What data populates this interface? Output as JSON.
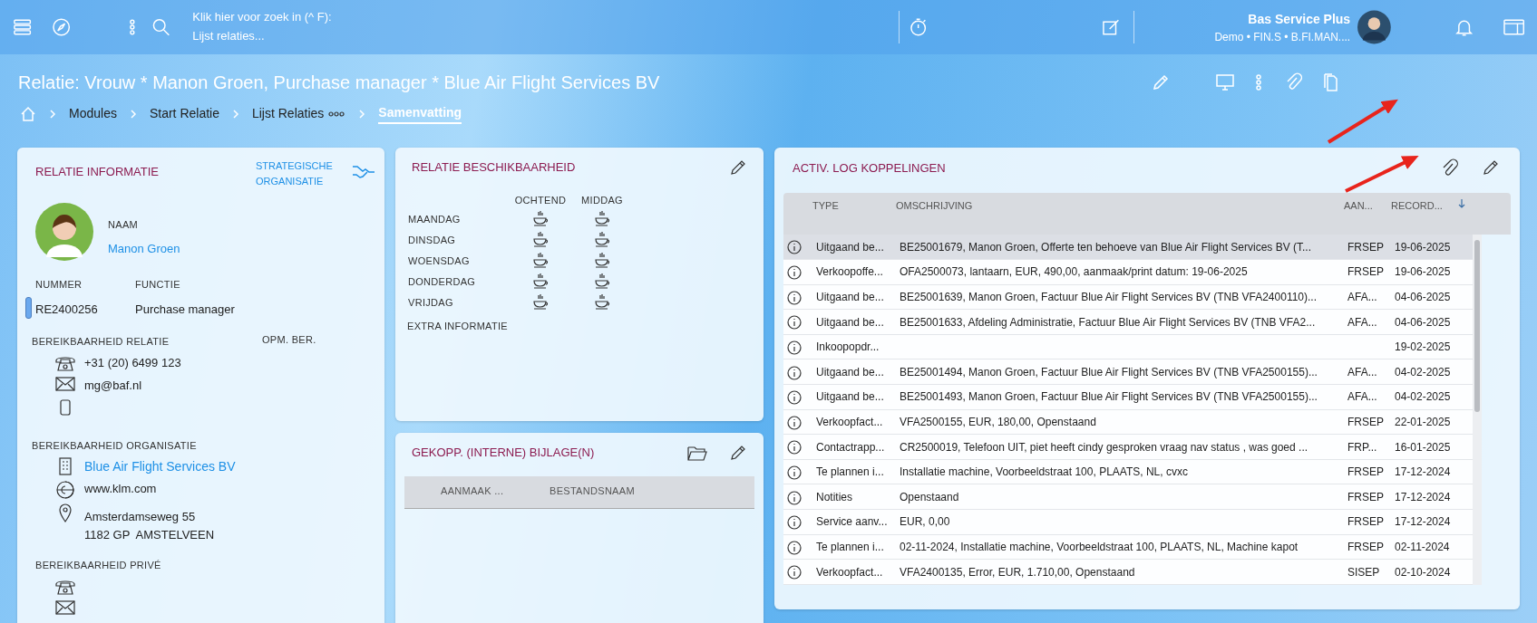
{
  "topbar": {
    "search_prompt": "Klik hier voor zoek in (^ F):",
    "search_context": "Lijst relaties...",
    "user_name": "Bas Service Plus",
    "user_context": "Demo • FIN.S • B.FI.MAN...."
  },
  "page_title": "Relatie: Vrouw * Manon Groen, Purchase manager * Blue Air Flight Services BV",
  "breadcrumbs": [
    {
      "label": "Modules",
      "menu": false,
      "selected": false
    },
    {
      "label": "Start Relatie",
      "menu": false,
      "selected": false
    },
    {
      "label": "Lijst Relaties",
      "menu": true,
      "selected": false
    },
    {
      "label": "Samenvatting",
      "menu": false,
      "selected": true
    }
  ],
  "relatie_informatie": {
    "title": "RELATIE INFORMATIE",
    "strategic_label": "STRATEGISCHE ORGANISATIE",
    "naam_label": "NAAM",
    "naam": "Manon Groen",
    "nummer_label": "NUMMER",
    "nummer": "RE2400256",
    "functie_label": "FUNCTIE",
    "functie": "Purchase manager",
    "bereikbaarheid_label": "BEREIKBAARHEID RELATIE",
    "opm_label": "OPM. BER.",
    "contacts": [
      {
        "kind": "phone",
        "text": "+31 (20) 6499 123"
      },
      {
        "kind": "email",
        "text": "mg@baf.nl"
      },
      {
        "kind": "mobile"
      }
    ],
    "organisatie_label": "BEREIKBAARHEID ORGANISATIE",
    "organisatie": [
      {
        "kind": "building",
        "text": "Blue Air Flight Services BV",
        "link": true
      },
      {
        "kind": "web",
        "text": "www.klm.com",
        "link": false
      },
      {
        "kind": "location",
        "lines": [
          "Amsterdamseweg 55",
          "1182 GP  AMSTELVEEN"
        ],
        "link": false
      }
    ],
    "prive_label": "BEREIKBAARHEID PRIVÉ",
    "prive": [
      {
        "kind": "phone"
      },
      {
        "kind": "email"
      }
    ]
  },
  "beschikbaarheid": {
    "title": "RELATIE BESCHIKBAARHEID",
    "columns": [
      "OCHTEND",
      "MIDDAG"
    ],
    "days": [
      {
        "label": "MAANDAG",
        "morning": true,
        "afternoon": true
      },
      {
        "label": "DINSDAG",
        "morning": true,
        "afternoon": true
      },
      {
        "label": "WOENSDAG",
        "morning": true,
        "afternoon": true
      },
      {
        "label": "DONDERDAG",
        "morning": true,
        "afternoon": true
      },
      {
        "label": "VRIJDAG",
        "morning": true,
        "afternoon": true
      }
    ],
    "extra_label": "EXTRA INFORMATIE"
  },
  "bijlagen": {
    "title": "GEKOPP. (INTERNE) BIJLAGE(N)",
    "columns": [
      "AANMAAK ...",
      "BESTANDSNAAM"
    ]
  },
  "log": {
    "title": "ACTIV. LOG KOPPELINGEN",
    "columns": [
      {
        "label": "TYPE",
        "sorted": false
      },
      {
        "label": "OMSCHRIJVING",
        "sorted": false
      },
      {
        "label": "AAN...",
        "sorted": false
      },
      {
        "label": "RECORD...",
        "sorted": true
      }
    ],
    "rows": [
      {
        "selected": true,
        "cells": [
          "Uitgaand be...",
          "BE25001679, Manon Groen, Offerte ten behoeve van Blue Air Flight Services BV (T...",
          "FRSEP",
          "19-06-2025"
        ]
      },
      {
        "selected": false,
        "cells": [
          "Verkoopoffe...",
          "OFA2500073, lantaarn, EUR, 490,00, aanmaak/print datum: 19-06-2025",
          "FRSEP",
          "19-06-2025"
        ]
      },
      {
        "selected": false,
        "cells": [
          "Uitgaand be...",
          "BE25001639, Manon Groen, Factuur Blue Air Flight Services BV (TNB VFA2400110)...",
          "AFA...",
          "04-06-2025"
        ]
      },
      {
        "selected": false,
        "cells": [
          "Uitgaand be...",
          "BE25001633, Afdeling Administratie, Factuur Blue Air Flight Services BV (TNB VFA2...",
          "AFA...",
          "04-06-2025"
        ]
      },
      {
        "selected": false,
        "cells": [
          "Inkoopopdr...",
          "",
          "",
          "19-02-2025"
        ]
      },
      {
        "selected": false,
        "cells": [
          "Uitgaand be...",
          "BE25001494, Manon Groen, Factuur Blue Air Flight Services BV (TNB VFA2500155)...",
          "AFA...",
          "04-02-2025"
        ]
      },
      {
        "selected": false,
        "cells": [
          "Uitgaand be...",
          "BE25001493, Manon Groen, Factuur Blue Air Flight Services BV (TNB VFA2500155)...",
          "AFA...",
          "04-02-2025"
        ]
      },
      {
        "selected": false,
        "cells": [
          "Verkoopfact...",
          "VFA2500155, EUR, 180,00, Openstaand",
          "FRSEP",
          "22-01-2025"
        ]
      },
      {
        "selected": false,
        "cells": [
          "Contactrapp...",
          "CR2500019, Telefoon UIT, piet heeft cindy gesproken vraag nav status , was goed ...",
          "FRP...",
          "16-01-2025"
        ]
      },
      {
        "selected": false,
        "cells": [
          "Te plannen i...",
          "Installatie machine, Voorbeeldstraat 100, PLAATS, NL, cvxc",
          "FRSEP",
          "17-12-2024"
        ]
      },
      {
        "selected": false,
        "cells": [
          "Notities",
          "Openstaand",
          "FRSEP",
          "17-12-2024"
        ]
      },
      {
        "selected": false,
        "cells": [
          "Service aanv...",
          "EUR, 0,00",
          "FRSEP",
          "17-12-2024"
        ]
      },
      {
        "selected": false,
        "cells": [
          "Te plannen i...",
          "02-11-2024, Installatie machine, Voorbeeldstraat 100, PLAATS, NL, Machine kapot",
          "FRSEP",
          "02-11-2024"
        ]
      },
      {
        "selected": false,
        "cells": [
          "Verkoopfact...",
          "VFA2400135, Error, EUR, 1.710,00, Openstaand",
          "SISEP",
          "02-10-2024"
        ]
      }
    ]
  }
}
